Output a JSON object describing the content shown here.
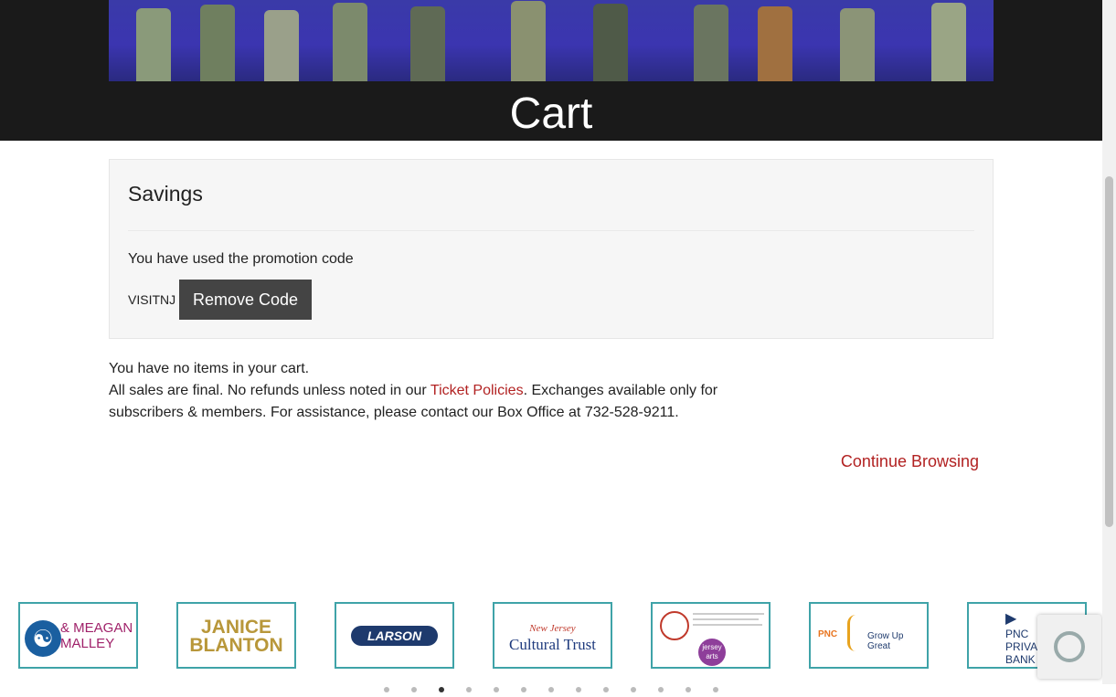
{
  "page": {
    "title": "Cart"
  },
  "savings": {
    "heading": "Savings",
    "promo_text": "You have used the promotion code",
    "promo_code": "VISITNJ",
    "remove_label": "Remove Code"
  },
  "cart": {
    "empty_msg": "You have no items in your cart.",
    "policy_pre": "All sales are final. No refunds unless noted in our ",
    "policy_link": "Ticket Policies",
    "policy_post": ". Exchanges available only for subscribers & members. For assistance, please contact our Box Office at 732-528-9211.",
    "continue_label": "Continue Browsing"
  },
  "sponsors": [
    {
      "line1": "& MEAGAN",
      "line2": "MALLEY"
    },
    {
      "line1": "JANICE",
      "line2": "BLANTON"
    },
    {
      "line1": "LARSON",
      "line2": ""
    },
    {
      "line1": "New Jersey",
      "line2": "Cultural Trust"
    },
    {
      "line1": "jersey",
      "line2": "arts"
    },
    {
      "line1": "PNC",
      "line2": "Grow Up Great"
    },
    {
      "line1": "PNC",
      "line2": "PRIVA BANK"
    }
  ],
  "colors": {
    "accent": "#b22222",
    "hero_bg": "#1a1a1a",
    "button_bg": "#444444",
    "sponsor_border": "#3fa3a8"
  }
}
